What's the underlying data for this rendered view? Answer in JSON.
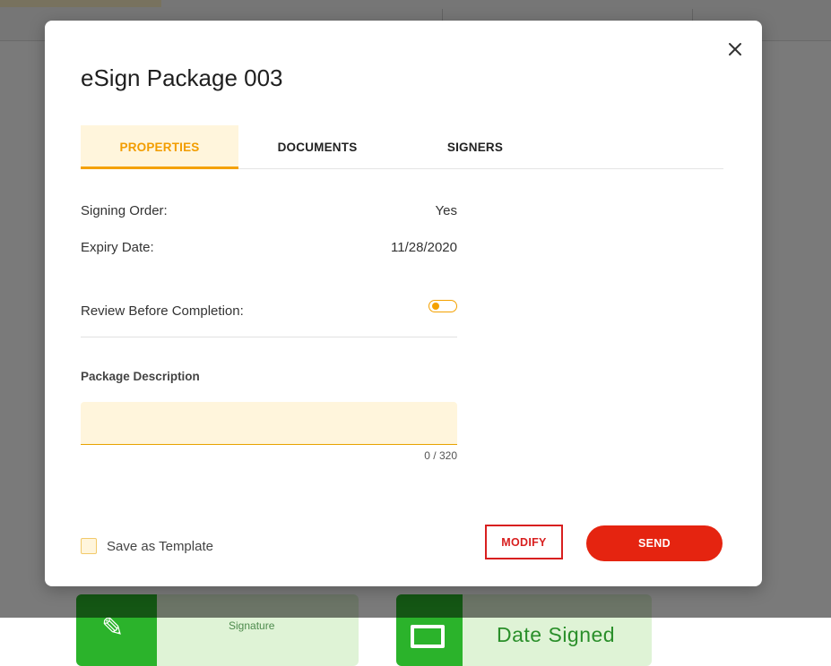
{
  "dialog": {
    "title": "eSign Package 003",
    "close_icon": "close-icon"
  },
  "tabs": [
    {
      "label": "PROPERTIES",
      "active": true
    },
    {
      "label": "DOCUMENTS",
      "active": false
    },
    {
      "label": "SIGNERS",
      "active": false
    }
  ],
  "properties": {
    "signing_order": {
      "label": "Signing Order:",
      "value": "Yes"
    },
    "expiry_date": {
      "label": "Expiry Date:",
      "value": "11/28/2020"
    },
    "review_before_completion": {
      "label": "Review Before Completion:",
      "enabled": false
    }
  },
  "description": {
    "label": "Package Description",
    "value": "",
    "counter": "0 / 320"
  },
  "footer": {
    "save_template_label": "Save as Template",
    "save_template_checked": false,
    "modify_label": "MODIFY",
    "send_label": "SEND"
  },
  "background": {
    "date_field_label": "Date Signed",
    "signature_field_label": "Signature"
  },
  "colors": {
    "accent": "#f4a100",
    "accent_bg": "#fff5dc",
    "danger": "#e52410",
    "field_green": "#2bb32b"
  }
}
